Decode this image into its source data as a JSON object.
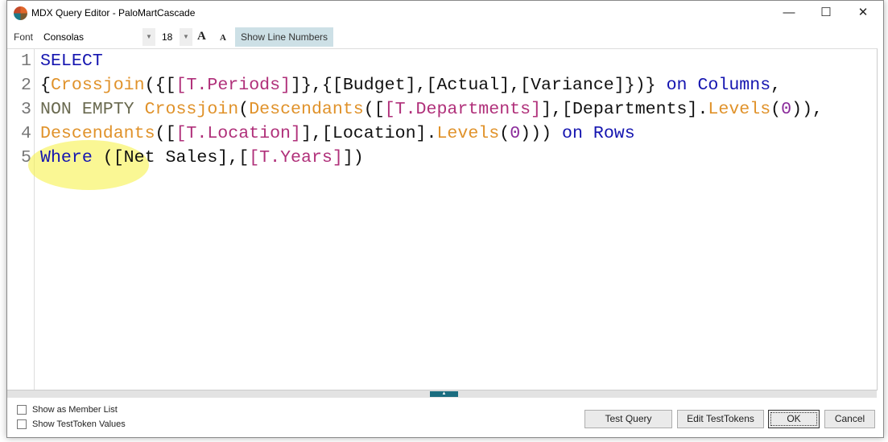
{
  "window": {
    "title": "MDX Query Editor - PaloMartCascade",
    "minimize": "—",
    "maximize": "☐",
    "close": "✕"
  },
  "toolbar": {
    "font_label": "Font",
    "font_value": "Consolas",
    "size_value": "18",
    "increase_font": "A",
    "decrease_font": "A",
    "show_line_numbers": "Show Line Numbers"
  },
  "editor": {
    "line_numbers": [
      "1",
      "2",
      "3",
      "4",
      "5"
    ],
    "lines": [
      [
        {
          "t": "SELECT",
          "c": "kw"
        }
      ],
      [
        {
          "t": "{",
          "c": "pl"
        },
        {
          "t": "Crossjoin",
          "c": "fn"
        },
        {
          "t": "({[",
          "c": "pl"
        },
        {
          "t": "[T.Periods]",
          "c": "mem"
        },
        {
          "t": "]},{[Budget],[Actual],[Variance]})} ",
          "c": "pl"
        },
        {
          "t": "on Columns",
          "c": "kw"
        },
        {
          "t": ",",
          "c": "pl"
        }
      ],
      [
        {
          "t": "NON EMPTY ",
          "c": "ne"
        },
        {
          "t": "Crossjoin",
          "c": "fn"
        },
        {
          "t": "(",
          "c": "pl"
        },
        {
          "t": "Descendants",
          "c": "fn"
        },
        {
          "t": "([",
          "c": "pl"
        },
        {
          "t": "[T.Departments]",
          "c": "mem"
        },
        {
          "t": "],[Departments].",
          "c": "pl"
        },
        {
          "t": "Levels",
          "c": "fn"
        },
        {
          "t": "(",
          "c": "pl"
        },
        {
          "t": "0",
          "c": "num"
        },
        {
          "t": ")),",
          "c": "pl"
        }
      ],
      [
        {
          "t": "Descendants",
          "c": "fn"
        },
        {
          "t": "([",
          "c": "pl"
        },
        {
          "t": "[T.Location]",
          "c": "mem"
        },
        {
          "t": "],[Location].",
          "c": "pl"
        },
        {
          "t": "Levels",
          "c": "fn"
        },
        {
          "t": "(",
          "c": "pl"
        },
        {
          "t": "0",
          "c": "num"
        },
        {
          "t": "))) ",
          "c": "pl"
        },
        {
          "t": "on Rows",
          "c": "kw"
        }
      ],
      [
        {
          "t": "Where ",
          "c": "kw"
        },
        {
          "t": "([Net Sales],[",
          "c": "pl"
        },
        {
          "t": "[T.Years]",
          "c": "mem"
        },
        {
          "t": "])",
          "c": "pl"
        }
      ]
    ]
  },
  "footer": {
    "show_member_list": "Show as Member List",
    "show_testtoken_values": "Show TestToken Values",
    "test_query": "Test Query",
    "edit_testtokens": "Edit TestTokens",
    "ok": "OK",
    "cancel": "Cancel"
  }
}
